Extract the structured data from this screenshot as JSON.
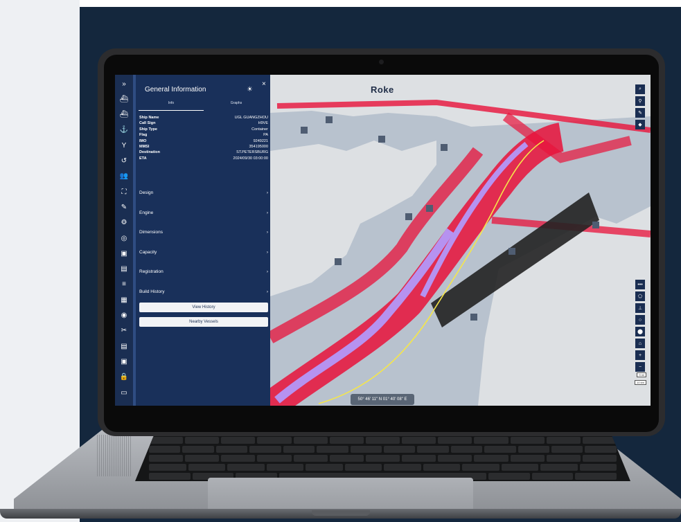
{
  "app": {
    "brand": "Roke",
    "rail_icons": [
      "expand-icon",
      "ship-outline-icon",
      "ship-icon",
      "anchor-icon",
      "antenna-icon",
      "history-icon",
      "people-icon",
      "frame-icon",
      "pen-icon",
      "satellite-icon",
      "radar-icon",
      "image-icon",
      "document-icon",
      "layers-icon",
      "map-icon",
      "compass-icon",
      "tools-icon",
      "file-icon",
      "save-icon",
      "lock-icon",
      "chat-icon"
    ],
    "rail_glyphs": [
      "»",
      "⛴",
      "⛴",
      "⚓",
      "Y",
      "↺",
      "👥",
      "⛶",
      "✎",
      "⚙",
      "◎",
      "▣",
      "▤",
      "≡",
      "▦",
      "◉",
      "✂",
      "▤",
      "▣",
      "🔒",
      "▭"
    ]
  },
  "panel": {
    "title": "General Information",
    "tabs": [
      "Info",
      "Graphs"
    ],
    "close_glyph": "×",
    "sun_glyph": "☀",
    "fields": [
      {
        "label": "Ship Name",
        "value": "UGL GUANGZHOU"
      },
      {
        "label": "Call Sign",
        "value": "H9VE"
      },
      {
        "label": "Ship Type",
        "value": "Container"
      },
      {
        "label": "Flag",
        "value": "PA"
      },
      {
        "label": "IMO",
        "value": "9249221"
      },
      {
        "label": "MMSI",
        "value": "354195000"
      },
      {
        "label": "Destination",
        "value": "ST.PETERSBURG"
      },
      {
        "label": "ETA",
        "value": "2024/09/30 03:00:00"
      }
    ],
    "sections": [
      "Design",
      "Engine",
      "Dimensions",
      "Capacity",
      "Registration",
      "Build History"
    ],
    "chevron": "›",
    "view_history": "View History",
    "nearby_vessels": "Nearby Vessels"
  },
  "map": {
    "coordinates": "50° 46' 11\" N 01° 40' 08\" E",
    "scale_top": "5 mi",
    "scale_bottom": "10 km",
    "tools_top": [
      "search-icon",
      "person-icon",
      "edit-icon",
      "layers-icon"
    ],
    "tools_top_glyphs": [
      "⌕",
      "⚲",
      "✎",
      "◆"
    ],
    "tools_bottom": [
      "more-icon",
      "polygon-icon",
      "pin-line-icon",
      "circle-icon",
      "marker-icon",
      "home-icon",
      "zoom-in-icon",
      "zoom-out-icon"
    ],
    "tools_bottom_glyphs": [
      "•••",
      "⬠",
      "⊥",
      "○",
      "⬤",
      "⌂",
      "+",
      "−"
    ],
    "colors": {
      "land": "#dde0e3",
      "sea": "#b8c2ce",
      "traffic": "#e8123a",
      "zone": "#b692f0",
      "track": "#f5e64a"
    }
  }
}
